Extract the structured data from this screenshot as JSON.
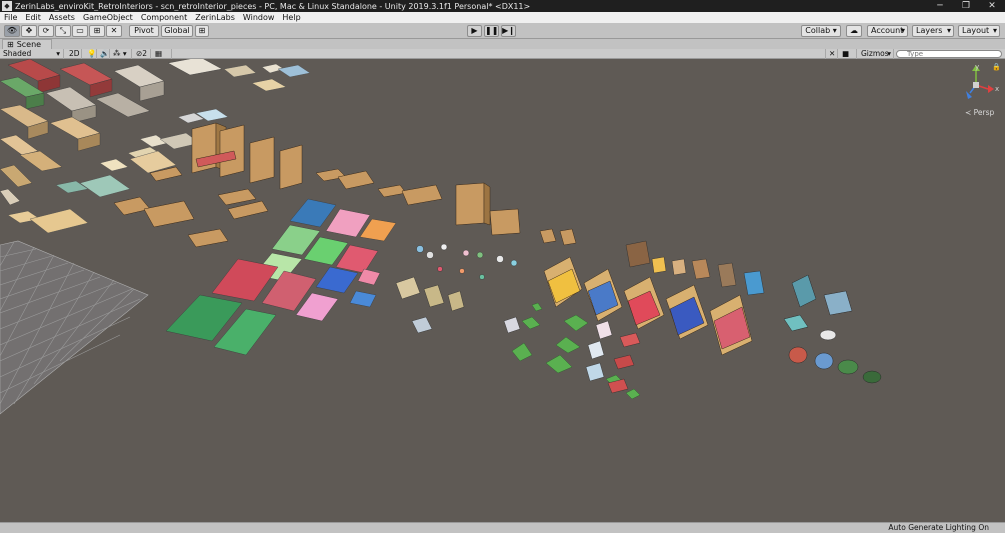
{
  "window": {
    "title": "ZerinLabs_enviroKit_RetroInteriors - scn_retroInterior_pieces - PC, Mac & Linux Standalone - Unity 2019.3.1f1 Personal* <DX11>",
    "icon": "unity-icon",
    "minimize": "─",
    "maximize": "❐",
    "close": "✕"
  },
  "menu": {
    "items": [
      "File",
      "Edit",
      "Assets",
      "GameObject",
      "Component",
      "ZerinLabs",
      "Window",
      "Help"
    ]
  },
  "toolbar": {
    "tools": [
      {
        "name": "hand-tool-icon",
        "glyph": "👁"
      },
      {
        "name": "move-tool-icon",
        "glyph": "✥"
      },
      {
        "name": "rotate-tool-icon",
        "glyph": "⟳"
      },
      {
        "name": "scale-tool-icon",
        "glyph": "⤡"
      },
      {
        "name": "rect-tool-icon",
        "glyph": "▭"
      },
      {
        "name": "transform-tool-icon",
        "glyph": "⊞"
      },
      {
        "name": "custom-tool-icon",
        "glyph": "✕"
      }
    ],
    "pivot_label": "Pivot",
    "global_label": "Global",
    "snap_glyph": "⊞",
    "play_glyph": "▶",
    "pause_glyph": "❚❚",
    "step_glyph": "▶❙",
    "collab_label": "Collab ▾",
    "cloud_glyph": "☁",
    "account_label": "Account",
    "layers_label": "Layers",
    "layout_label": "Layout",
    "dropdown_glyph": "▾"
  },
  "scene": {
    "tab_label": "Scene",
    "tab_glyph": "⊞",
    "shading_mode": "Shaded",
    "mode_2d": "2D",
    "light_glyph": "💡",
    "audio_glyph": "🔊",
    "effects_glyph": "⁂",
    "hidden_count": "2",
    "grid_glyph": "▦",
    "gizmos_label": "Gizmos",
    "search_placeholder": "Type",
    "camera_glyph": "■",
    "tool_glyph": "✕",
    "lock_glyph": "🔒",
    "persp_label": "≺ Persp"
  },
  "gizmo": {
    "y": "y",
    "x": "x"
  },
  "status": {
    "text": "Auto Generate Lighting On"
  },
  "colors": {
    "titlebar": "#1f1f1f",
    "menubar": "#f0f0f0",
    "toolbar": "#c2c2c2",
    "viewport_bg": "#5f5a55",
    "grid": "#9a9a9a",
    "axis_x": "#e04040",
    "axis_y": "#80c040",
    "axis_z": "#4080e0"
  }
}
